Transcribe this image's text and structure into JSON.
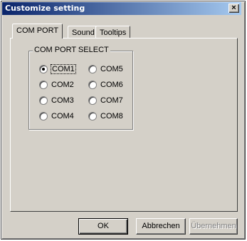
{
  "window": {
    "title": "Customize setting",
    "close_label": "×"
  },
  "tabs": [
    {
      "label": "COM PORT",
      "active": true
    },
    {
      "label": "Sound",
      "active": false
    },
    {
      "label": "Tooltips",
      "active": false
    }
  ],
  "group": {
    "title": "COM PORT SELECT"
  },
  "ports": [
    {
      "label": "COM1",
      "selected": true
    },
    {
      "label": "COM2",
      "selected": false
    },
    {
      "label": "COM3",
      "selected": false
    },
    {
      "label": "COM4",
      "selected": false
    },
    {
      "label": "COM5",
      "selected": false
    },
    {
      "label": "COM6",
      "selected": false
    },
    {
      "label": "COM7",
      "selected": false
    },
    {
      "label": "COM8",
      "selected": false
    }
  ],
  "buttons": {
    "ok": "OK",
    "cancel": "Abbrechen",
    "apply": "Übernehmen",
    "apply_enabled": false
  },
  "colors": {
    "face": "#d4d0c8",
    "titlebar_start": "#0a246a",
    "titlebar_end": "#a6caf0"
  }
}
